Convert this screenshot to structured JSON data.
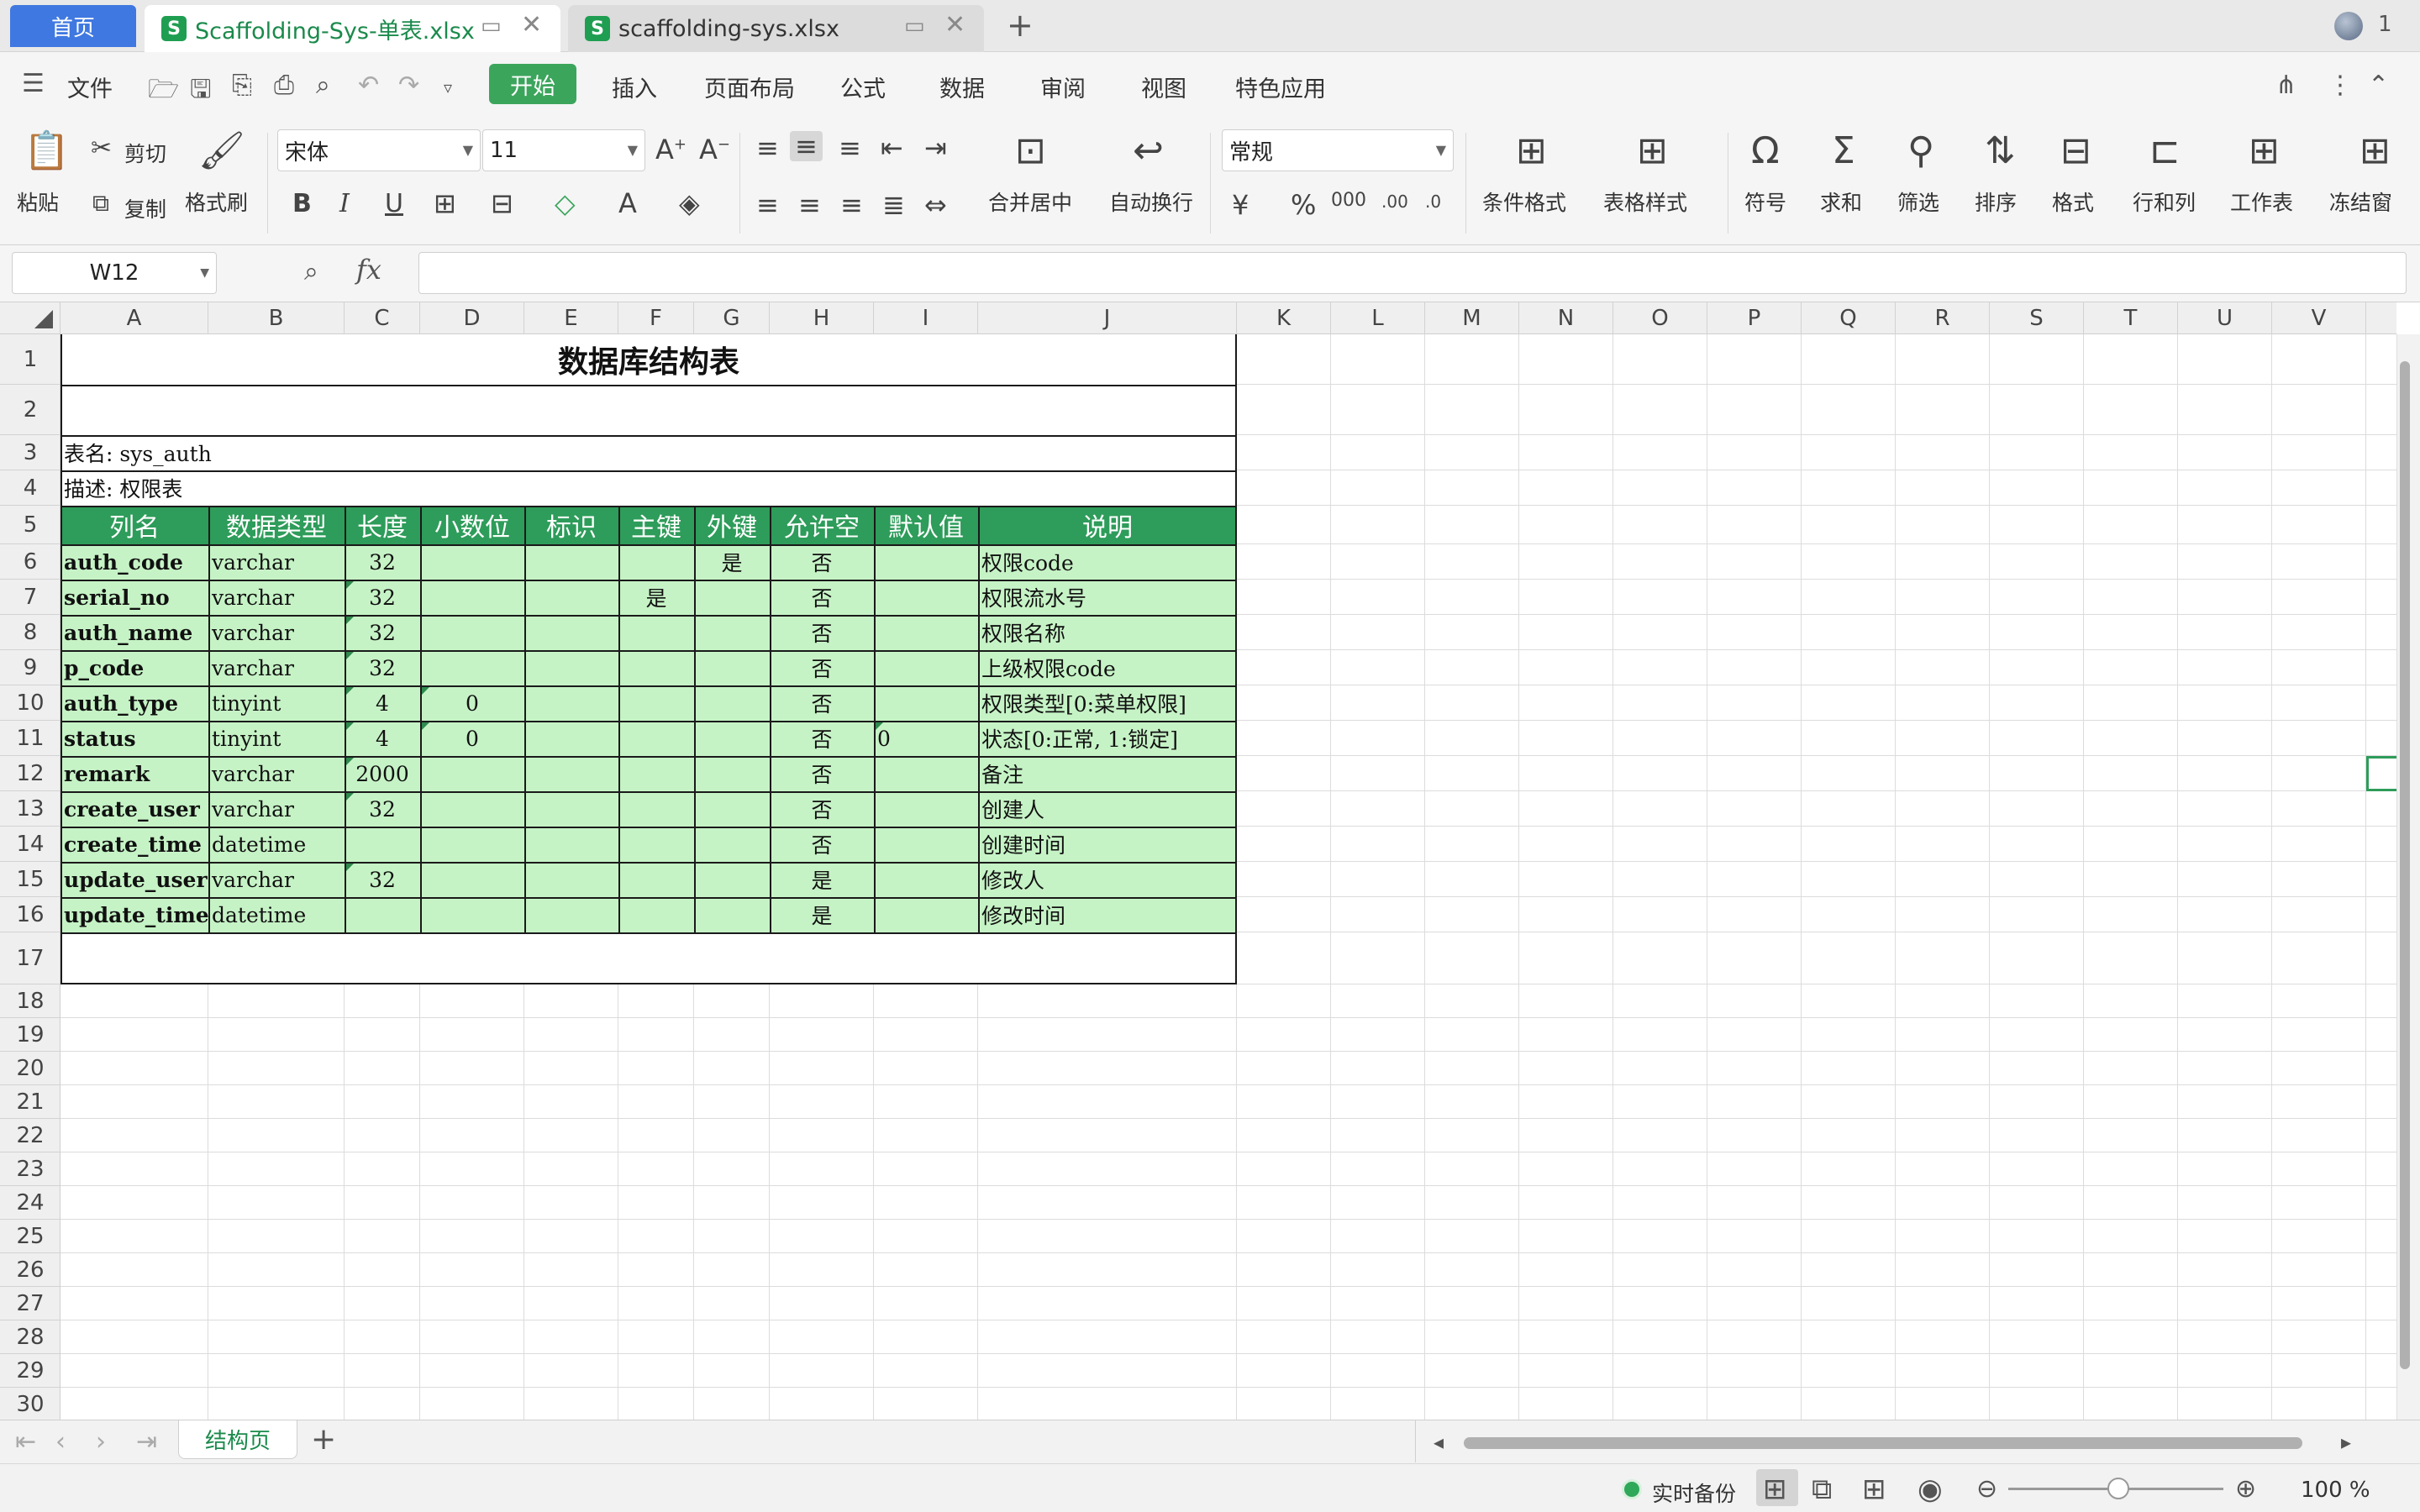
{
  "tabs": {
    "home": "首页",
    "doc1": "Scaffolding-Sys-单表.xlsx",
    "doc2": "scaffolding-sys.xlsx",
    "xls_icon_letter": "S",
    "user_count": "1"
  },
  "menu": {
    "file": "文件",
    "items": [
      "开始",
      "插入",
      "页面布局",
      "公式",
      "数据",
      "审阅",
      "视图",
      "特色应用"
    ]
  },
  "ribbon": {
    "paste": "粘贴",
    "cut": "剪切",
    "copy": "复制",
    "format_painter": "格式刷",
    "font_name": "宋体",
    "font_size": "11",
    "bold": "B",
    "italic": "I",
    "underline": "U",
    "merge_center": "合并居中",
    "wrap_text": "自动换行",
    "number_format": "常规",
    "percent": "%",
    "conditional_format": "条件格式",
    "table_style": "表格样式",
    "symbol": "符号",
    "sum": "求和",
    "filter": "筛选",
    "sort": "排序",
    "format": "格式",
    "rows_cols": "行和列",
    "worksheet": "工作表",
    "freeze": "冻结窗"
  },
  "formula_bar": {
    "name_box": "W12",
    "fx": "fx",
    "formula": ""
  },
  "columns": [
    "A",
    "B",
    "C",
    "D",
    "E",
    "F",
    "G",
    "H",
    "I",
    "J",
    "K",
    "L",
    "M",
    "N",
    "O",
    "P",
    "Q",
    "R",
    "S",
    "T",
    "U",
    "V"
  ],
  "rows": [
    "1",
    "2",
    "3",
    "4",
    "5",
    "6",
    "7",
    "8",
    "9",
    "10",
    "11",
    "12",
    "13",
    "14",
    "15",
    "16",
    "17",
    "18",
    "19",
    "20",
    "21",
    "22",
    "23",
    "24",
    "25",
    "26",
    "27",
    "28",
    "29",
    "30"
  ],
  "sheet": {
    "title": "数据库结构表",
    "table_name": "表名: sys_auth",
    "description": "描述: 权限表",
    "headers": [
      "列名",
      "数据类型",
      "长度",
      "小数位",
      "标识",
      "主键",
      "外键",
      "允许空",
      "默认值",
      "说明"
    ],
    "data_rows": [
      [
        "auth_code",
        "varchar",
        "32",
        "",
        "",
        "",
        "是",
        "否",
        "",
        "权限code"
      ],
      [
        "serial_no",
        "varchar",
        "32",
        "",
        "",
        "是",
        "",
        "否",
        "",
        "权限流水号"
      ],
      [
        "auth_name",
        "varchar",
        "32",
        "",
        "",
        "",
        "",
        "否",
        "",
        "权限名称"
      ],
      [
        "p_code",
        "varchar",
        "32",
        "",
        "",
        "",
        "",
        "否",
        "",
        "上级权限code"
      ],
      [
        "auth_type",
        "tinyint",
        "4",
        "0",
        "",
        "",
        "",
        "否",
        "",
        "权限类型[0:菜单权限]"
      ],
      [
        "status",
        "tinyint",
        "4",
        "0",
        "",
        "",
        "",
        "否",
        "0",
        "状态[0:正常, 1:锁定]"
      ],
      [
        "remark",
        "varchar",
        "2000",
        "",
        "",
        "",
        "",
        "否",
        "",
        "备注"
      ],
      [
        "create_user",
        "varchar",
        "32",
        "",
        "",
        "",
        "",
        "否",
        "",
        "创建人"
      ],
      [
        "create_time",
        "datetime",
        "",
        "",
        "",
        "",
        "",
        "否",
        "",
        "创建时间"
      ],
      [
        "update_user",
        "varchar",
        "32",
        "",
        "",
        "",
        "",
        "是",
        "",
        "修改人"
      ],
      [
        "update_time",
        "datetime",
        "",
        "",
        "",
        "",
        "",
        "是",
        "",
        "修改时间"
      ]
    ]
  },
  "sheet_tab": "结构页",
  "status": {
    "backup": "实时备份",
    "zoom": "100 %"
  },
  "colors": {
    "accent_green": "#2e9c5a",
    "header_fill": "#2e9c5a",
    "row_fill": "#c6f3c6",
    "home_tab": "#3f78e0"
  }
}
